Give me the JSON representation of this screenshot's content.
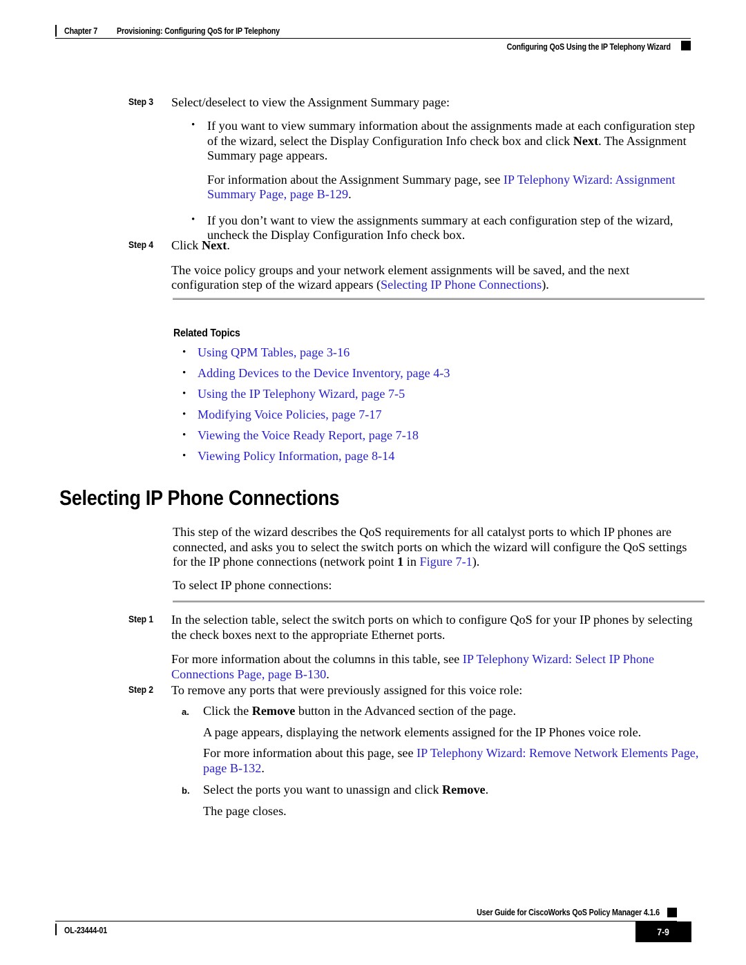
{
  "header": {
    "chapter": "Chapter 7",
    "chapter_title": "Provisioning: Configuring QoS for IP Telephony",
    "section": "Configuring QoS Using the IP Telephony Wizard"
  },
  "footer": {
    "guide_title": "User Guide for CiscoWorks QoS Policy Manager 4.1.6",
    "doc_id": "OL-23444-01",
    "page_number": "7-9"
  },
  "link_color": "#2a22cf",
  "steps": {
    "step3": {
      "label": "Step 3",
      "intro": "Select/deselect to view the Assignment Summary page:",
      "bullet1_a": "If you want to view summary information about the assignments made at each configuration step of the wizard, select the Display Configuration Info check box and click ",
      "bullet1_bold": "Next",
      "bullet1_b": ". The Assignment Summary page appears.",
      "bullet1_sub_a": "For information about the Assignment Summary page, see ",
      "bullet1_sub_link": "IP Telephony Wizard: Assignment Summary Page, page B-129",
      "bullet1_sub_b": ".",
      "bullet2": "If you don’t want to view the assignments summary at each configuration step of the wizard, uncheck the Display Configuration Info check box."
    },
    "step4": {
      "label": "Step 4",
      "click_a": "Click ",
      "click_bold": "Next",
      "click_b": ".",
      "para_a": "The voice policy groups and your network element assignments will be saved, and the next configuration step of the wizard appears (",
      "para_link": "Selecting IP Phone Connections",
      "para_b": ")."
    },
    "step1": {
      "label": "Step 1",
      "para1": "In the selection table, select the switch ports on which to configure QoS for your IP phones by selecting the check boxes next to the appropriate Ethernet ports.",
      "para2_a": "For more information about the columns in this table, see ",
      "para2_link": "IP Telephony Wizard: Select IP Phone Connections Page, page B-130",
      "para2_b": "."
    },
    "step2": {
      "label": "Step 2",
      "intro": "To remove any ports that were previously assigned for this voice role:",
      "item_a_marker": "a.",
      "item_a_1": "Click the ",
      "item_a_bold": "Remove",
      "item_a_2": " button in the Advanced section of the page.",
      "item_a_p2": "A page appears, displaying the network elements assigned for the IP Phones voice role.",
      "item_a_p3_a": "For more information about this page, see ",
      "item_a_p3_link": "IP Telephony Wizard: Remove Network Elements Page, page B-132",
      "item_a_p3_b": ".",
      "item_b_marker": "b.",
      "item_b_1": "Select the ports you want to unassign and click ",
      "item_b_bold": "Remove",
      "item_b_2": ".",
      "item_b_p2": "The page closes."
    }
  },
  "related_topics": {
    "heading": "Related Topics",
    "links": [
      "Using QPM Tables, page 3-16",
      "Adding Devices to the Device Inventory, page 4-3",
      "Using the IP Telephony Wizard, page 7-5",
      "Modifying Voice Policies, page 7-17",
      "Viewing the Voice Ready Report, page 7-18",
      "Viewing Policy Information, page 8-14"
    ]
  },
  "section": {
    "heading": "Selecting IP Phone Connections",
    "intro_a": "This step of the wizard describes the QoS requirements for all catalyst ports to which IP phones are connected, and asks you to select the switch ports on which the wizard will configure the QoS settings for the IP phone connections (network point ",
    "intro_bold": "1",
    "intro_b": " in ",
    "intro_link": "Figure 7-1",
    "intro_c": ").",
    "intro2": "To select IP phone connections:"
  }
}
